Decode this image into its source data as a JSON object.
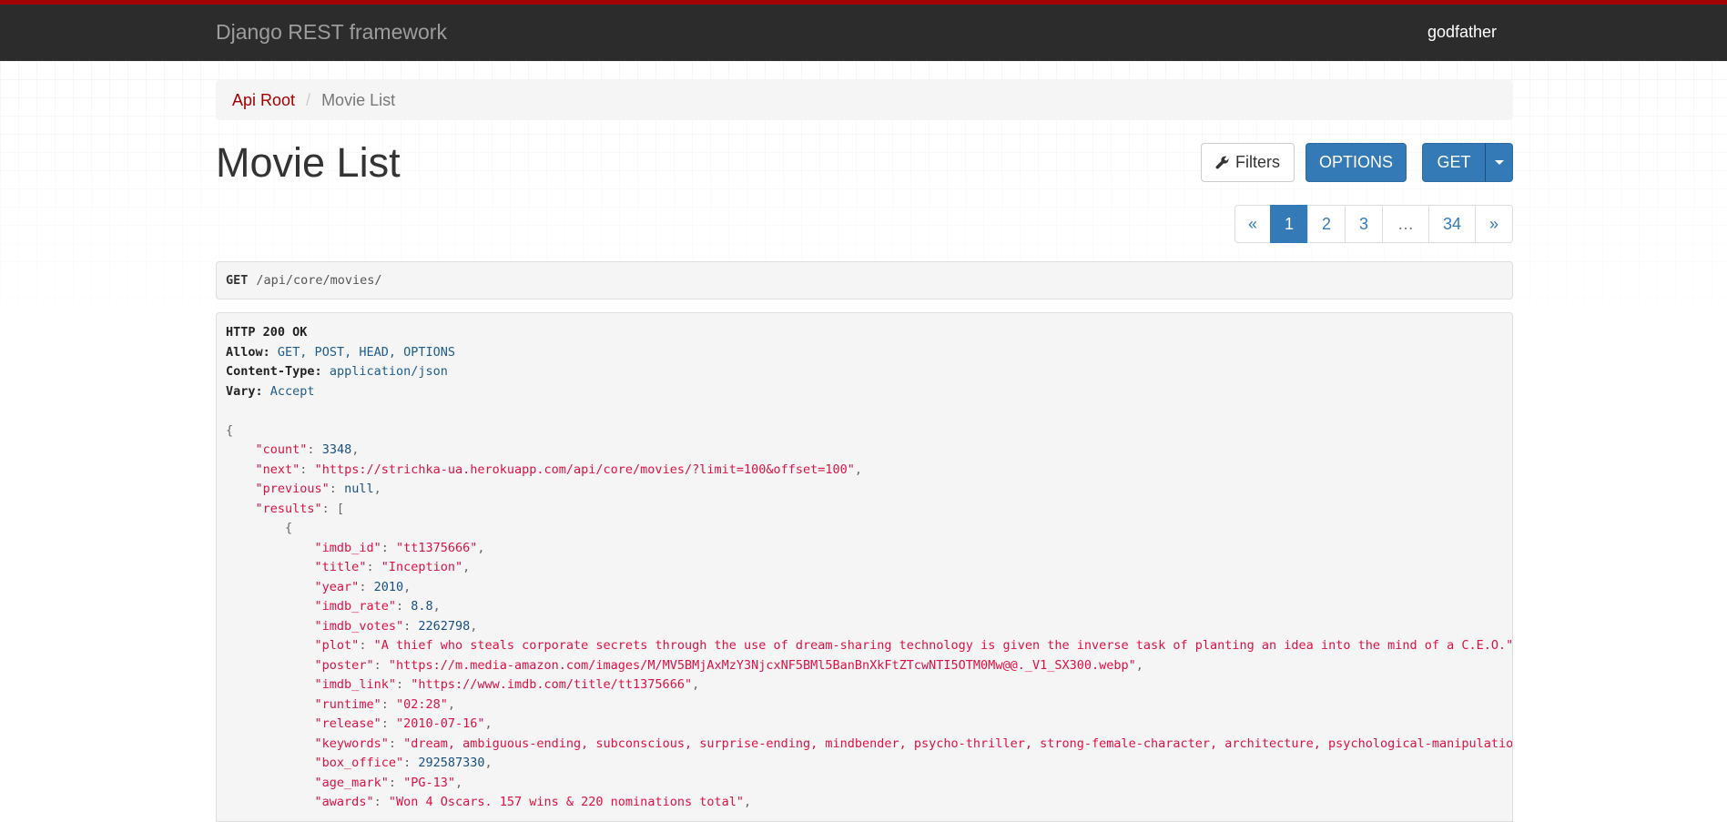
{
  "navbar": {
    "brand": "Django REST framework",
    "user": "godfather"
  },
  "breadcrumb": {
    "root": "Api Root",
    "current": "Movie List"
  },
  "page": {
    "title": "Movie List"
  },
  "buttons": {
    "filters": "Filters",
    "options": "OPTIONS",
    "get": "GET"
  },
  "pagination": {
    "prev": "«",
    "pages": [
      "1",
      "2",
      "3"
    ],
    "ellipsis": "…",
    "last": "34",
    "next": "»",
    "active": "1"
  },
  "request": {
    "method": "GET",
    "path": "/api/core/movies/"
  },
  "response": {
    "status": "HTTP 200 OK",
    "headers": [
      {
        "key": "Allow:",
        "value": "GET, POST, HEAD, OPTIONS"
      },
      {
        "key": "Content-Type:",
        "value": "application/json"
      },
      {
        "key": "Vary:",
        "value": "Accept"
      }
    ],
    "count": "3348",
    "next": "\"https://strichka-ua.herokuapp.com/api/core/movies/?limit=100&offset=100\"",
    "previous": "null",
    "result": {
      "imdb_id": "\"tt1375666\"",
      "title": "\"Inception\"",
      "year": "2010",
      "imdb_rate": "8.8",
      "imdb_votes": "2262798",
      "plot": "\"A thief who steals corporate secrets through the use of dream-sharing technology is given the inverse task of planting an idea into the mind of a C.E.O.\"",
      "poster": "\"https://m.media-amazon.com/images/M/MV5BMjAxMzY3NjcxNF5BMl5BanBnXkFtZTcwNTI5OTM0Mw@@._V1_SX300.webp\"",
      "imdb_link": "\"https://www.imdb.com/title/tt1375666\"",
      "runtime": "\"02:28\"",
      "release": "\"2010-07-16\"",
      "keywords": "\"dream, ambiguous-ending, subconscious, surprise-ending, mindbender, psycho-thriller, strong-female-character, architecture, psychological-manipulation\"",
      "box_office": "292587330",
      "age_mark": "\"PG-13\"",
      "awards": "\"Won 4 Oscars. 157 wins & 220 nominations total\""
    }
  }
}
